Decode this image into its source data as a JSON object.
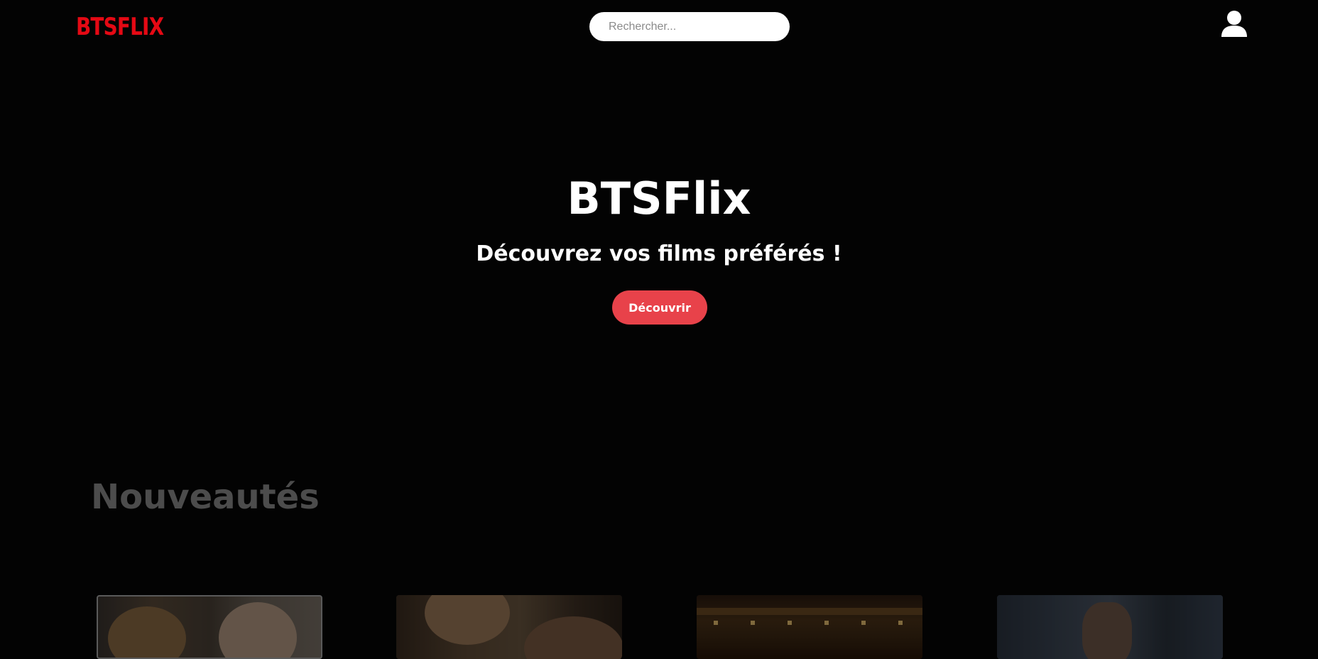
{
  "header": {
    "logo": "BTSFLIX",
    "search_placeholder": "Rechercher...",
    "user_icon": "user-icon"
  },
  "hero": {
    "title": "BTSFlix",
    "subtitle": "Découvrez vos films préférés !",
    "button_label": "Découvrir"
  },
  "sections": [
    {
      "title": "Nouveautés",
      "cards": [
        {
          "icon": "movie-poster"
        },
        {
          "icon": "movie-poster"
        },
        {
          "icon": "movie-poster"
        },
        {
          "icon": "movie-poster"
        }
      ]
    }
  ],
  "colors": {
    "background": "#030303",
    "brand": "#e50914",
    "button": "#e8424a",
    "section_title": "#4c4c4c",
    "text": "#ffffff"
  }
}
